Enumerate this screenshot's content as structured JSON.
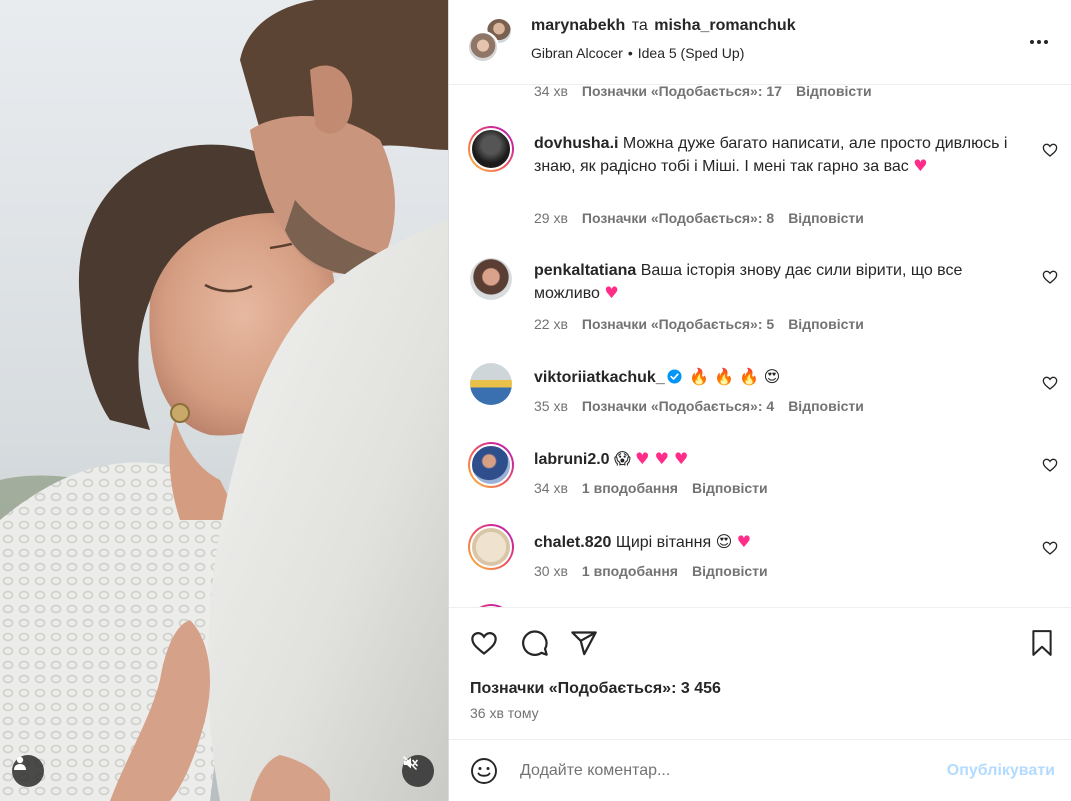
{
  "post": {
    "author_1": "marynabekh",
    "conjunction": "та",
    "author_2": "misha_romanchuk",
    "audio_artist": "Gibran Alcocer",
    "audio_separator": "•",
    "audio_track": "Idea 5 (Sped Up)",
    "more_icon": "more-horizontal-icon"
  },
  "top_comment_meta": {
    "time": "34 хв",
    "likes": "Позначки «Подобається»: 17",
    "reply": "Відповісти"
  },
  "comments": [
    {
      "user": "dovhusha.i",
      "text": "Можна дуже багато написати, але просто дивлюсь і знаю, як радісно тобі і Міші. І мені так гарно за вас",
      "emoji": "♥",
      "time": "29 хв",
      "likes": "Позначки «Подобається»: 8",
      "reply": "Відповісти"
    },
    {
      "user": "penkaltatiana",
      "text": "Ваша історія знову дає сили вірити, що все можливо",
      "emoji": "♥",
      "time": "22 хв",
      "likes": "Позначки «Подобається»: 5",
      "reply": "Відповісти"
    },
    {
      "user": "viktoriiatkachuk_",
      "text": "",
      "emoji": "🔥 🔥 🔥",
      "emoji_2": "😍",
      "verified": true,
      "time": "35 хв",
      "likes": "Позначки «Подобається»: 4",
      "reply": "Відповісти"
    },
    {
      "user": "labruni2.0",
      "text": "",
      "emoji": "😱",
      "emoji_2": "♥ ♥ ♥",
      "time": "34 хв",
      "likes": "1 вподобання",
      "reply": "Відповісти"
    },
    {
      "user": "chalet.820",
      "text": "Щирі вітання",
      "emoji": "😍",
      "emoji_2": "♥",
      "time": "30 хв",
      "likes": "1 вподобання",
      "reply": "Відповісти"
    }
  ],
  "actions": {
    "like_icon": "heart-icon",
    "comment_icon": "comment-icon",
    "share_icon": "share-icon",
    "save_icon": "bookmark-icon",
    "likes_total": "Позначки «Подобається»: 3 456",
    "time_ago": "36 хв тому"
  },
  "composer": {
    "placeholder": "Додайте коментар...",
    "publish_label": "Опублікувати",
    "emoji_icon": "smiley-icon"
  },
  "media": {
    "tag_icon": "user-tag-icon",
    "mute_icon": "speaker-muted-icon"
  },
  "colors": {
    "accent_blue": "#0095f6",
    "publish_disabled": "#b3dbff",
    "secondary_text": "#737373",
    "verified_badge": "#0095f6"
  }
}
